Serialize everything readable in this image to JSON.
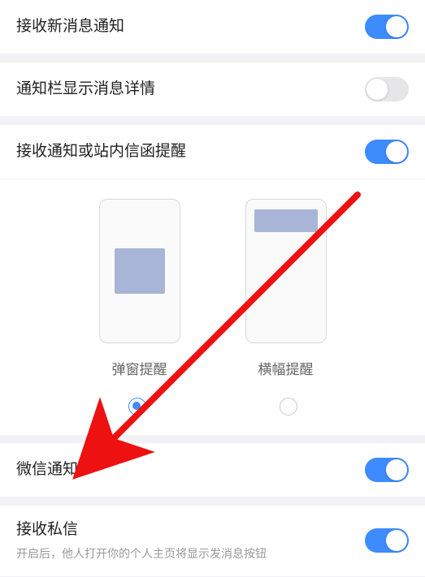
{
  "settings": {
    "newMessage": {
      "label": "接收新消息通知",
      "on": true
    },
    "showDetail": {
      "label": "通知栏显示消息详情",
      "on": false
    },
    "inMail": {
      "label": "接收通知或站内信函提醒",
      "on": true
    },
    "wechat": {
      "label": "微信通知",
      "on": true
    },
    "dm": {
      "label": "接收私信",
      "on": true,
      "sub": "开启后，他人打开你的个人主页将显示发消息按钮"
    }
  },
  "preview": {
    "popup": {
      "label": "弹窗提醒",
      "selected": true
    },
    "banner": {
      "label": "横幅提醒",
      "selected": false
    }
  },
  "annotation": {
    "arrow_color": "#e11",
    "target": "wechat"
  }
}
